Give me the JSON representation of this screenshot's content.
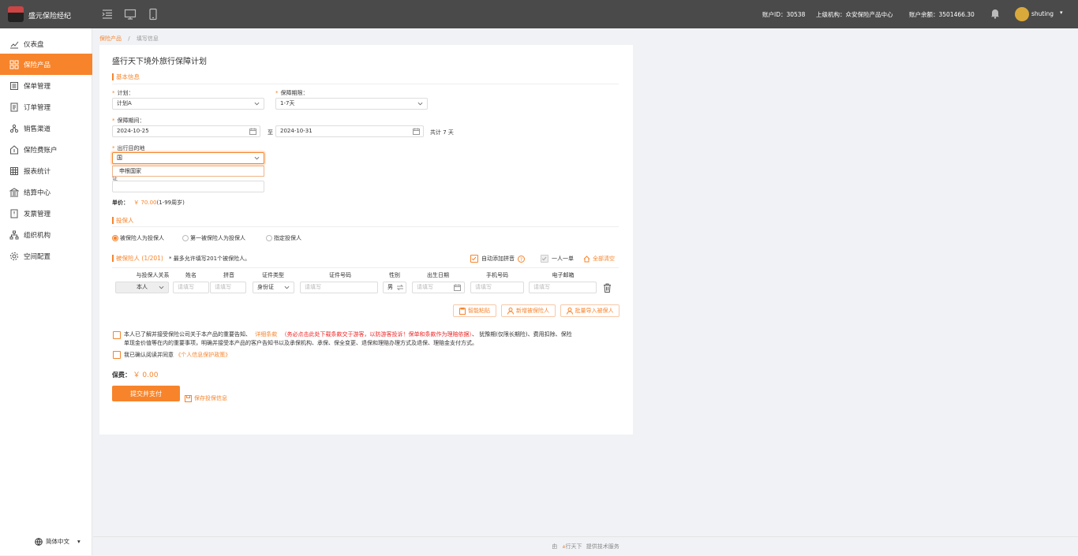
{
  "app": {
    "brand": "盛元保险经纪"
  },
  "topbar": {
    "account_id": "账户ID：30538",
    "parent_org": "上级机构：众安保险产品中心",
    "balance": "账户余额：3501466.30",
    "username": "shuting",
    "icons": [
      "indent-icon",
      "desktop-icon",
      "mobile-icon",
      "bell-icon",
      "avatar",
      "caret-down-icon"
    ]
  },
  "sidebar": {
    "items": [
      {
        "label": "仪表盘",
        "icon": "chart-icon"
      },
      {
        "label": "保险产品",
        "icon": "grid-icon",
        "active": true
      },
      {
        "label": "保单管理",
        "icon": "list-icon"
      },
      {
        "label": "订单管理",
        "icon": "doc-icon"
      },
      {
        "label": "销售渠道",
        "icon": "share-icon"
      },
      {
        "label": "保险费账户",
        "icon": "wallet-icon"
      },
      {
        "label": "报表统计",
        "icon": "table-icon"
      },
      {
        "label": "结算中心",
        "icon": "bank-icon"
      },
      {
        "label": "发票管理",
        "icon": "invoice-icon"
      },
      {
        "label": "组织机构",
        "icon": "org-icon"
      },
      {
        "label": "空间配置",
        "icon": "gear-icon"
      }
    ],
    "lang": "简体中文"
  },
  "breadcrumb": {
    "root": "保险产品",
    "sep": "/",
    "current": "填写信息"
  },
  "form": {
    "title": "盛行天下境外旅行保障计划",
    "basic_section": "基本信息",
    "plan_label": "计划：",
    "plan_value": "计划A",
    "term_label": "保障期限：",
    "term_value": "1-7天",
    "period_label": "保障期间：",
    "start_date": "2024-10-25",
    "to": "至",
    "end_date": "2024-10-31",
    "total_days": "共计 7 天",
    "dest_label": "出行目的地",
    "dest_value": "国",
    "dest_option": "申根国家",
    "hidden_label": "证",
    "unit_price_label": "单价：",
    "unit_price": "￥ 70.00",
    "unit_price_note": "(1-99周岁)",
    "applicant_section": "投保人",
    "radio_options": [
      "被保险人为投保人",
      "第一被保险人为投保人",
      "指定投保人"
    ],
    "insured_section": "被保险人",
    "insured_count": "(1/201)",
    "insured_note": "* 最多允许填写201个被保险人。",
    "auto_pinyin": "自动添加拼音",
    "one_per": "一人一单",
    "clear_all": "全部清空",
    "table_headers": [
      "与投保人关系",
      "姓名",
      "拼音",
      "证件类型",
      "证件号码",
      "性别",
      "出生日期",
      "手机号码",
      "电子邮箱"
    ],
    "row": {
      "relation": "本人",
      "name_ph": "请填写",
      "pinyin_ph": "请填写",
      "id_type": "身份证",
      "id_ph": "请填写",
      "gender": "男",
      "birth_ph": "请填写",
      "phone_ph": "请填写",
      "email_ph": "请填写"
    },
    "btn_smart_paste": "智能粘贴",
    "btn_add_insured": "新增被保险人",
    "btn_batch_import": "批量导入被保人",
    "agree1_a": "本人已了解并接受保险公司关于本产品的重要告知、",
    "agree1_link": "详细条款",
    "agree1_red": "（务必点击此处下载条款交于游客，以防游客投诉！保单和条款作为理赔依据）",
    "agree1_b": "、 犹豫期(仅限长期险)、费用扣除、保险",
    "agree1_c": "单现金价值等在内的重要事项，明确并接受本产品的客户告知书以及承保机构、承保、保全变更、退保和理赔办理方式及退保、理赔金支付方式。",
    "agree2_a": "我已确认阅读并同意",
    "agree2_link": "《个人信息保护政策》",
    "premium_label": "保费：",
    "premium": "￥ 0.00",
    "submit": "提交并支付",
    "save": "保存投保信息"
  },
  "footer": {
    "prefix": "由",
    "brand": "行天下",
    "suffix": "提供技术服务"
  },
  "colors": {
    "accent": "#f7842b",
    "topbar": "#4a4a4a"
  }
}
